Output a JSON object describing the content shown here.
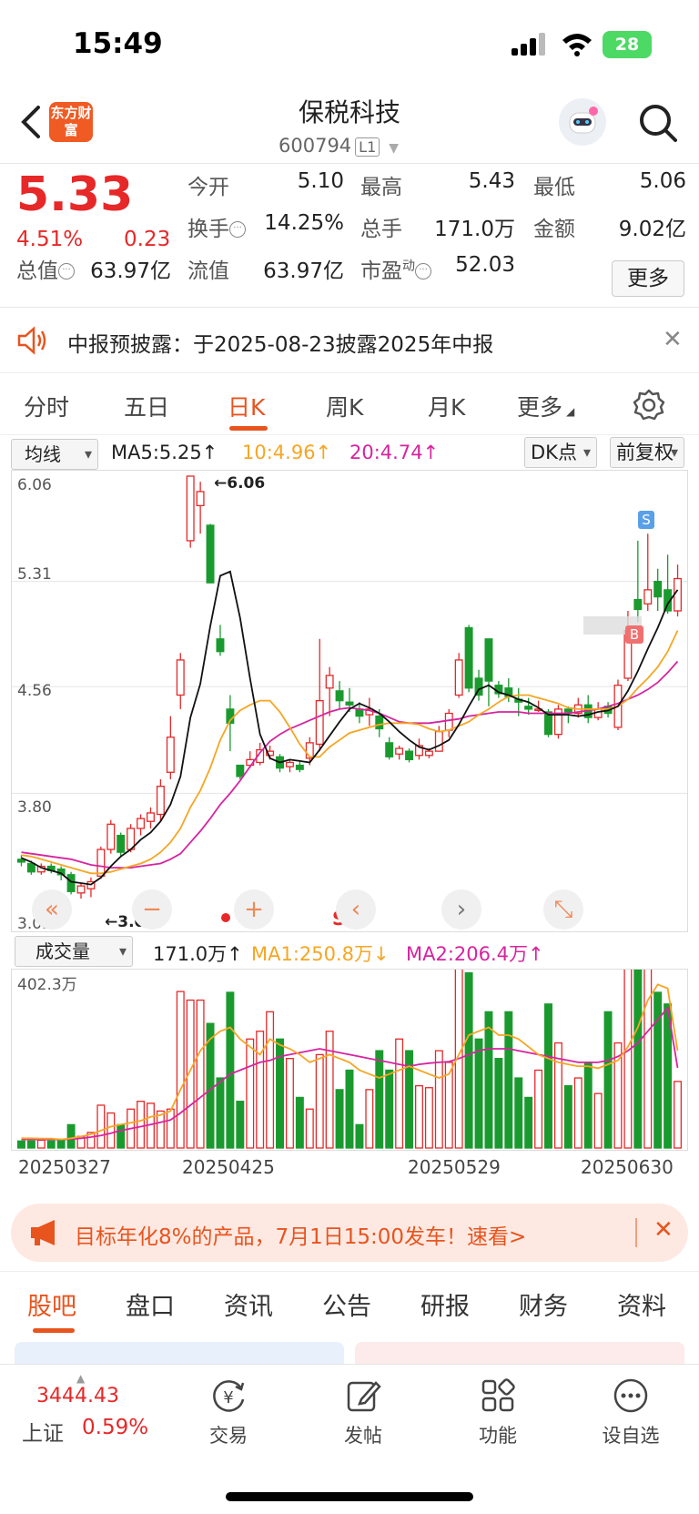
{
  "status": {
    "time": "15:49",
    "battery": "28"
  },
  "nav": {
    "logo": "东方财富",
    "name": "保税科技",
    "code": "600794",
    "level": "L1"
  },
  "quote": {
    "price": "5.33",
    "pct": "4.51%",
    "change": "0.23",
    "open_label": "今开",
    "open": "5.10",
    "high_label": "最高",
    "high": "5.43",
    "low_label": "最低",
    "low": "5.06",
    "turnover_label": "换手",
    "turnover": "14.25%",
    "volume_label": "总手",
    "volume": "171.0万",
    "amount_label": "金额",
    "amount": "9.02亿",
    "mcap_label": "总值",
    "mcap": "63.97亿",
    "float_label": "流值",
    "float": "63.97亿",
    "pe_label": "市盈",
    "pe_sup": "动",
    "pe": "52.03",
    "more": "更多"
  },
  "notice": {
    "text": "中报预披露：于2025-08-23披露2025年中报"
  },
  "tabs": [
    "分时",
    "五日",
    "日K",
    "周K",
    "月K",
    "更多"
  ],
  "ma_bar": {
    "selector": "均线",
    "ma5": "MA5:5.25↑",
    "ma10": "10:4.96↑",
    "ma20": "20:4.74↑",
    "dk": "DK点",
    "adjust": "前复权"
  },
  "colors": {
    "up": "#e62828",
    "down": "#1a9a2e",
    "ma5": "#111111",
    "ma10": "#f5a623",
    "ma20": "#d6249f",
    "accent": "#e8541e"
  },
  "kchart": {
    "y_labels": [
      "6.06",
      "5.31",
      "4.56",
      "3.80",
      "3.05"
    ],
    "max_label": "←6.06",
    "min_label": "←3.05",
    "buy_marker": "B",
    "sell_marker": "S",
    "s_mark": "S",
    "controls": [
      "«",
      "−",
      "+",
      "‹",
      "›",
      "⤡"
    ]
  },
  "vol_bar": {
    "selector": "成交量",
    "vol": "171.0万↑",
    "ma1": "MA1:250.8万↓",
    "ma2": "MA2:206.4万↑"
  },
  "vchart": {
    "max_label": "402.3万"
  },
  "dates": [
    "20250327",
    "20250425",
    "20250529",
    "20250630"
  ],
  "chart_data": {
    "type": "candlestick",
    "ylim": [
      3.05,
      6.06
    ],
    "candles": [
      [
        3.33,
        3.31,
        3.36,
        3.28
      ],
      [
        3.3,
        3.24,
        3.32,
        3.22
      ],
      [
        3.24,
        3.28,
        3.3,
        3.22
      ],
      [
        3.28,
        3.25,
        3.3,
        3.23
      ],
      [
        3.26,
        3.22,
        3.28,
        3.18
      ],
      [
        3.22,
        3.1,
        3.24,
        3.08
      ],
      [
        3.09,
        3.14,
        3.16,
        3.05
      ],
      [
        3.12,
        3.17,
        3.2,
        3.06
      ],
      [
        3.21,
        3.4,
        3.42,
        3.19
      ],
      [
        3.4,
        3.58,
        3.61,
        3.37
      ],
      [
        3.5,
        3.38,
        3.52,
        3.35
      ],
      [
        3.4,
        3.55,
        3.58,
        3.38
      ],
      [
        3.55,
        3.62,
        3.65,
        3.5
      ],
      [
        3.6,
        3.66,
        3.7,
        3.55
      ],
      [
        3.65,
        3.85,
        3.9,
        3.6
      ],
      [
        3.95,
        4.2,
        4.35,
        3.9
      ],
      [
        4.5,
        4.75,
        4.8,
        4.4
      ],
      [
        5.6,
        6.06,
        6.06,
        5.55
      ],
      [
        5.85,
        5.95,
        6.02,
        5.65
      ],
      [
        5.71,
        5.3,
        5.72,
        5.3
      ],
      [
        4.9,
        4.81,
        5.0,
        4.78
      ],
      [
        4.4,
        4.3,
        4.5,
        4.1
      ],
      [
        4.0,
        3.92,
        4.0,
        3.9
      ],
      [
        4.0,
        4.04,
        4.1,
        3.98
      ],
      [
        4.02,
        4.11,
        4.16,
        4.0
      ],
      [
        4.07,
        4.1,
        4.14,
        4.04
      ],
      [
        4.06,
        3.98,
        4.08,
        3.95
      ],
      [
        3.99,
        4.02,
        4.04,
        3.95
      ],
      [
        4.0,
        3.97,
        4.03,
        3.95
      ],
      [
        4.05,
        4.16,
        4.2,
        4.0
      ],
      [
        4.15,
        4.46,
        4.9,
        4.1
      ],
      [
        4.55,
        4.64,
        4.7,
        4.35
      ],
      [
        4.53,
        4.46,
        4.6,
        4.4
      ],
      [
        4.45,
        4.43,
        4.55,
        4.38
      ],
      [
        4.4,
        4.35,
        4.45,
        4.3
      ],
      [
        4.36,
        4.4,
        4.48,
        4.28
      ],
      [
        4.35,
        4.26,
        4.4,
        4.2
      ],
      [
        4.16,
        4.06,
        4.2,
        4.04
      ],
      [
        4.08,
        4.12,
        4.14,
        4.04
      ],
      [
        4.1,
        4.04,
        4.12,
        4.02
      ],
      [
        4.07,
        4.14,
        4.19,
        4.04
      ],
      [
        4.07,
        4.1,
        4.12,
        4.05
      ],
      [
        4.1,
        4.24,
        4.28,
        4.1
      ],
      [
        4.25,
        4.37,
        4.4,
        4.2
      ],
      [
        4.5,
        4.75,
        4.8,
        4.48
      ],
      [
        4.98,
        4.55,
        5.0,
        4.52
      ],
      [
        4.62,
        4.5,
        4.68,
        4.46
      ],
      [
        4.9,
        4.6,
        4.88,
        4.42
      ],
      [
        4.57,
        4.51,
        4.6,
        4.48
      ],
      [
        4.55,
        4.49,
        4.62,
        4.45
      ],
      [
        4.47,
        4.45,
        4.55,
        4.35
      ],
      [
        4.42,
        4.4,
        4.48,
        4.36
      ],
      [
        4.4,
        4.4,
        4.46,
        4.38
      ],
      [
        4.38,
        4.22,
        4.4,
        4.2
      ],
      [
        4.22,
        4.4,
        4.43,
        4.19
      ],
      [
        4.4,
        4.38,
        4.42,
        4.3
      ],
      [
        4.37,
        4.43,
        4.48,
        4.34
      ],
      [
        4.43,
        4.34,
        4.5,
        4.3
      ],
      [
        4.34,
        4.4,
        4.45,
        4.32
      ],
      [
        4.42,
        4.37,
        4.45,
        4.34
      ],
      [
        4.27,
        4.57,
        4.61,
        4.25
      ],
      [
        4.62,
        4.96,
        5.1,
        4.6
      ],
      [
        5.18,
        5.11,
        5.6,
        5.02
      ],
      [
        5.15,
        5.25,
        5.65,
        5.1
      ],
      [
        5.31,
        5.2,
        5.4,
        5.1
      ],
      [
        5.25,
        5.1,
        5.5,
        5.08
      ],
      [
        5.1,
        5.33,
        5.43,
        5.06
      ]
    ],
    "ma5": [
      3.34,
      3.31,
      3.27,
      3.25,
      3.23,
      3.17,
      3.16,
      3.15,
      3.2,
      3.28,
      3.35,
      3.4,
      3.47,
      3.52,
      3.6,
      3.72,
      3.92,
      4.34,
      4.58,
      4.99,
      5.35,
      5.38,
      5.05,
      4.62,
      4.22,
      4.05,
      4.02,
      4.04,
      4.03,
      4.02,
      4.11,
      4.21,
      4.31,
      4.4,
      4.44,
      4.41,
      4.37,
      4.31,
      4.24,
      4.18,
      4.13,
      4.11,
      4.14,
      4.18,
      4.29,
      4.42,
      4.54,
      4.57,
      4.52,
      4.5,
      4.47,
      4.45,
      4.41,
      4.36,
      4.36,
      4.36,
      4.35,
      4.36,
      4.38,
      4.39,
      4.42,
      4.53,
      4.67,
      4.83,
      4.98,
      5.15,
      5.25
    ],
    "ma10": [
      3.36,
      3.35,
      3.33,
      3.31,
      3.29,
      3.27,
      3.25,
      3.23,
      3.23,
      3.24,
      3.26,
      3.28,
      3.3,
      3.33,
      3.38,
      3.45,
      3.55,
      3.7,
      3.82,
      3.98,
      4.18,
      4.32,
      4.39,
      4.43,
      4.46,
      4.46,
      4.38,
      4.27,
      4.15,
      4.06,
      4.06,
      4.13,
      4.18,
      4.23,
      4.25,
      4.27,
      4.29,
      4.3,
      4.3,
      4.3,
      4.29,
      4.26,
      4.24,
      4.25,
      4.28,
      4.31,
      4.36,
      4.4,
      4.45,
      4.49,
      4.5,
      4.5,
      4.48,
      4.46,
      4.44,
      4.41,
      4.4,
      4.4,
      4.4,
      4.4,
      4.42,
      4.47,
      4.55,
      4.62,
      4.7,
      4.81,
      4.96
    ],
    "ma20": [
      3.38,
      3.37,
      3.36,
      3.35,
      3.34,
      3.33,
      3.31,
      3.29,
      3.28,
      3.27,
      3.27,
      3.27,
      3.28,
      3.29,
      3.3,
      3.33,
      3.37,
      3.45,
      3.53,
      3.62,
      3.72,
      3.8,
      3.89,
      3.99,
      4.09,
      4.17,
      4.22,
      4.26,
      4.29,
      4.32,
      4.35,
      4.38,
      4.4,
      4.41,
      4.4,
      4.39,
      4.37,
      4.34,
      4.31,
      4.3,
      4.3,
      4.3,
      4.31,
      4.32,
      4.33,
      4.35,
      4.36,
      4.37,
      4.38,
      4.38,
      4.38,
      4.37,
      4.37,
      4.37,
      4.37,
      4.37,
      4.38,
      4.39,
      4.4,
      4.42,
      4.44,
      4.47,
      4.5,
      4.54,
      4.59,
      4.66,
      4.74
    ],
    "volume": [
      18,
      18,
      20,
      18,
      20,
      60,
      30,
      40,
      110,
      90,
      60,
      100,
      120,
      115,
      95,
      100,
      402,
      380,
      380,
      320,
      180,
      400,
      120,
      280,
      300,
      350,
      280,
      230,
      130,
      100,
      240,
      300,
      150,
      200,
      60,
      150,
      250,
      200,
      280,
      250,
      160,
      155,
      250,
      220,
      500,
      450,
      280,
      350,
      230,
      350,
      180,
      130,
      200,
      370,
      270,
      160,
      180,
      220,
      140,
      350,
      270,
      460,
      480,
      560,
      400,
      370,
      171
    ],
    "ma1": [
      25,
      25,
      24,
      24,
      22,
      25,
      30,
      35,
      45,
      55,
      60,
      65,
      70,
      80,
      85,
      95,
      150,
      200,
      250,
      280,
      300,
      310,
      280,
      260,
      240,
      280,
      265,
      255,
      240,
      220,
      230,
      240,
      230,
      220,
      200,
      190,
      180,
      190,
      200,
      210,
      200,
      190,
      180,
      190,
      240,
      290,
      300,
      310,
      290,
      290,
      280,
      260,
      240,
      230,
      220,
      215,
      210,
      210,
      205,
      215,
      225,
      260,
      310,
      380,
      420,
      410,
      250
    ],
    "ma2": [
      22,
      22,
      22,
      22,
      22,
      23,
      25,
      28,
      32,
      38,
      45,
      50,
      55,
      60,
      66,
      72,
      90,
      110,
      130,
      150,
      170,
      190,
      200,
      210,
      220,
      225,
      235,
      240,
      245,
      250,
      255,
      250,
      245,
      240,
      235,
      230,
      225,
      220,
      215,
      210,
      215,
      218,
      220,
      222,
      230,
      240,
      250,
      255,
      255,
      255,
      250,
      245,
      240,
      235,
      230,
      225,
      220,
      220,
      220,
      225,
      235,
      250,
      270,
      300,
      330,
      360,
      206
    ]
  },
  "promo": {
    "text": "目标年化8%的产品，7月1日15:00发车！速看>"
  },
  "bottom_tabs": [
    "股吧",
    "盘口",
    "资讯",
    "公告",
    "研报",
    "财务",
    "资料"
  ],
  "bottom_bar": {
    "index_value": "3444.43",
    "index_name": "上证",
    "index_pct": "0.59%",
    "items": [
      "交易",
      "发帖",
      "功能",
      "设自选"
    ]
  }
}
